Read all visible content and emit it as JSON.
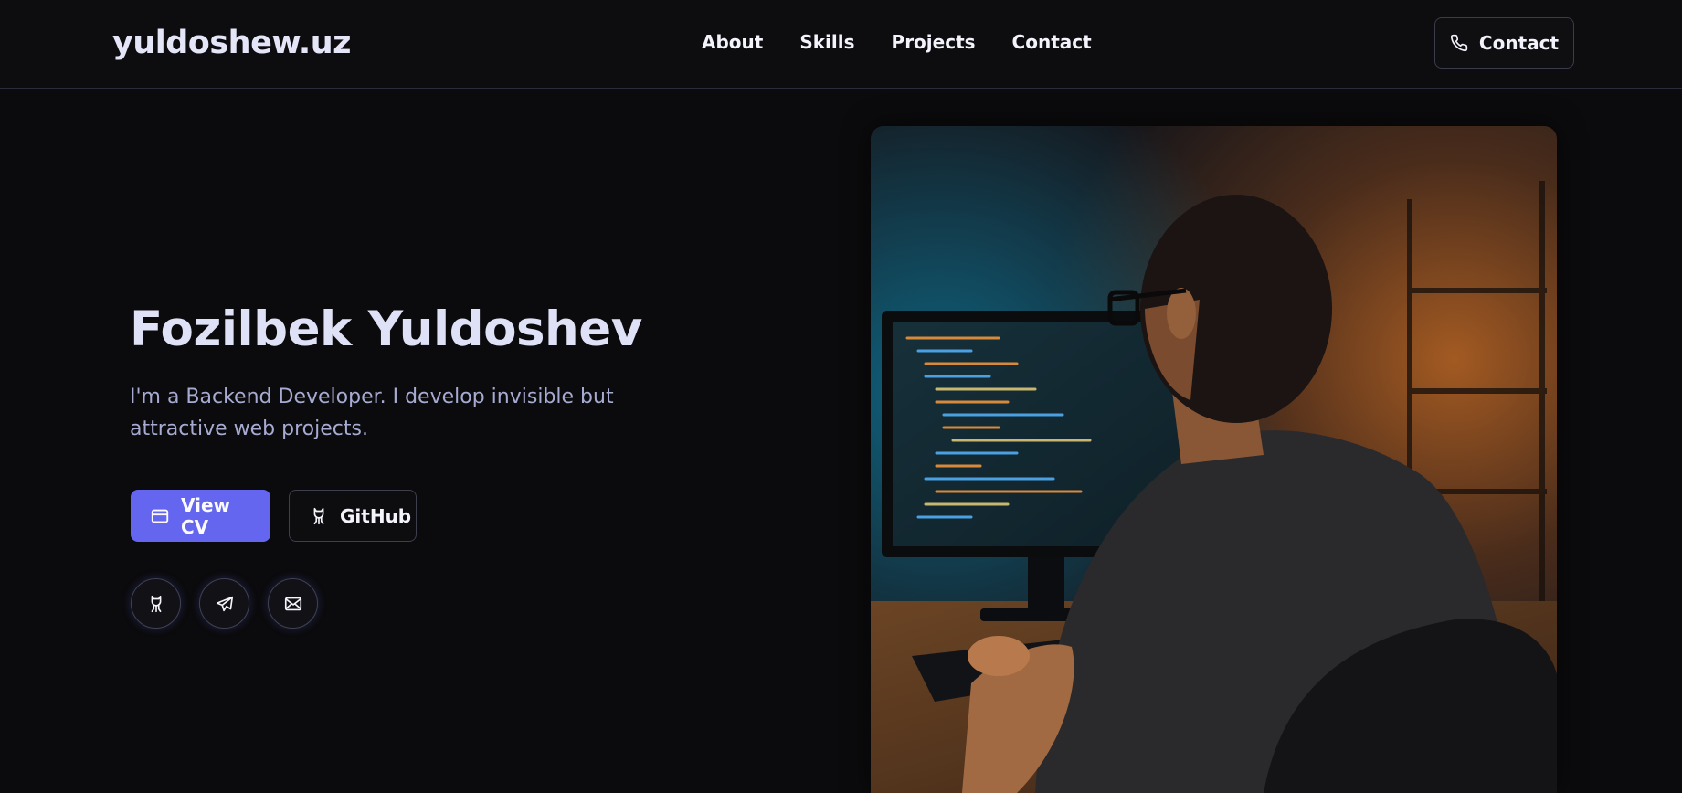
{
  "brand": {
    "name": "yuldoshew.uz"
  },
  "nav": {
    "items": [
      "About",
      "Skills",
      "Projects",
      "Contact"
    ]
  },
  "header": {
    "contact_label": "Contact",
    "contact_icon": "phone-icon"
  },
  "hero": {
    "title": "Fozilbek Yuldoshev",
    "subtitle": "I'm a Backend Developer. I develop invisible but attractive web projects.",
    "buttons": {
      "view_cv": {
        "label": "View CV",
        "icon": "browser-window-icon"
      },
      "github": {
        "label": "GitHub",
        "icon": "github-icon"
      }
    },
    "socials": [
      {
        "icon": "github-icon"
      },
      {
        "icon": "telegram-icon"
      },
      {
        "icon": "mail-icon"
      }
    ]
  },
  "colors": {
    "accent": "#6466ef",
    "background": "#0b0b0d",
    "subtitle": "#a7abd2"
  }
}
